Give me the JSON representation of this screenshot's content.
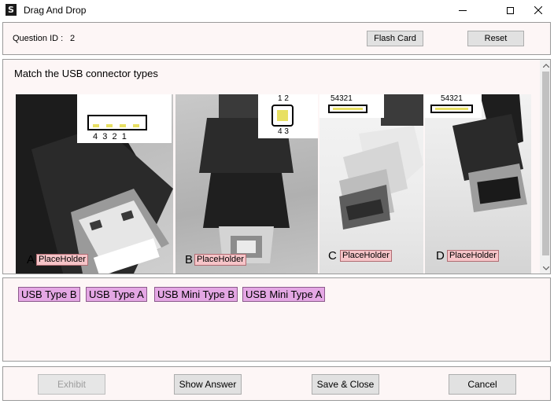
{
  "window": {
    "title": "Drag And Drop",
    "app_icon_glyph": "S"
  },
  "header": {
    "question_id_label": "Question ID :",
    "question_id_value": "2",
    "flash_card_label": "Flash Card",
    "reset_label": "Reset"
  },
  "content": {
    "prompt": "Match the USB connector types",
    "images": [
      {
        "letter": "A",
        "placeholder": "PlaceHolder",
        "pin_label": "4  3  2  1"
      },
      {
        "letter": "B",
        "placeholder": "PlaceHolder",
        "pin_top": "1 2",
        "pin_bottom": "4 3"
      },
      {
        "letter": "C",
        "placeholder": "PlaceHolder",
        "pin_label": "54321"
      },
      {
        "letter": "D",
        "placeholder": "PlaceHolder",
        "pin_label": "54321"
      }
    ]
  },
  "answers": [
    "USB Type B",
    "USB Type A",
    "USB Mini Type B",
    "USB Mini Type A"
  ],
  "footer": {
    "exhibit_label": "Exhibit",
    "show_answer_label": "Show Answer",
    "save_close_label": "Save & Close",
    "cancel_label": "Cancel"
  },
  "colors": {
    "panel_bg": "#fdf6f6",
    "placeholder_bg": "#f6c4c8",
    "answer_chip_bg": "#e4a7e4"
  }
}
